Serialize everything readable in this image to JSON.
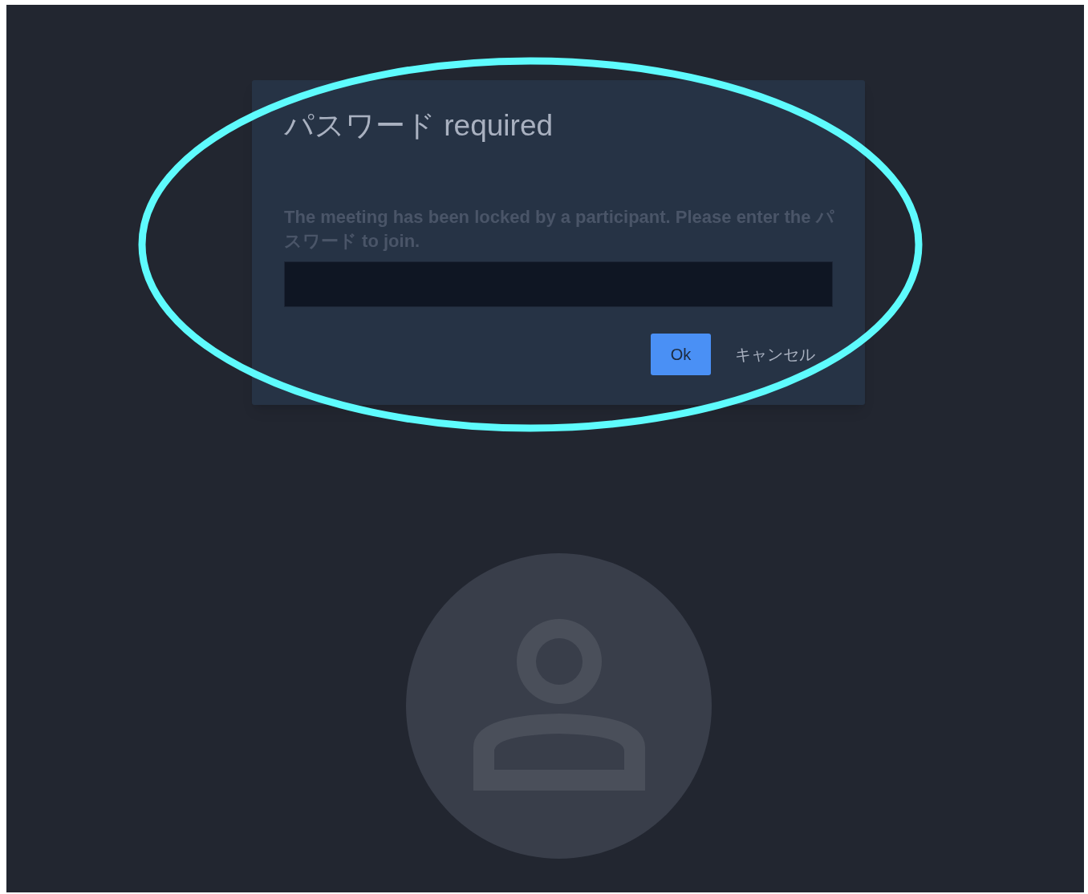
{
  "dialog": {
    "title": "パスワード required",
    "message": "The meeting has been locked by a participant. Please enter the パスワード to join.",
    "buttons": [
      {
        "label": "Ok",
        "kind": "primary"
      },
      {
        "label": "キャンセル",
        "kind": "text"
      }
    ]
  },
  "avatar": {
    "kind": "placeholder"
  },
  "annotation": {
    "kind": "ellipse"
  }
}
